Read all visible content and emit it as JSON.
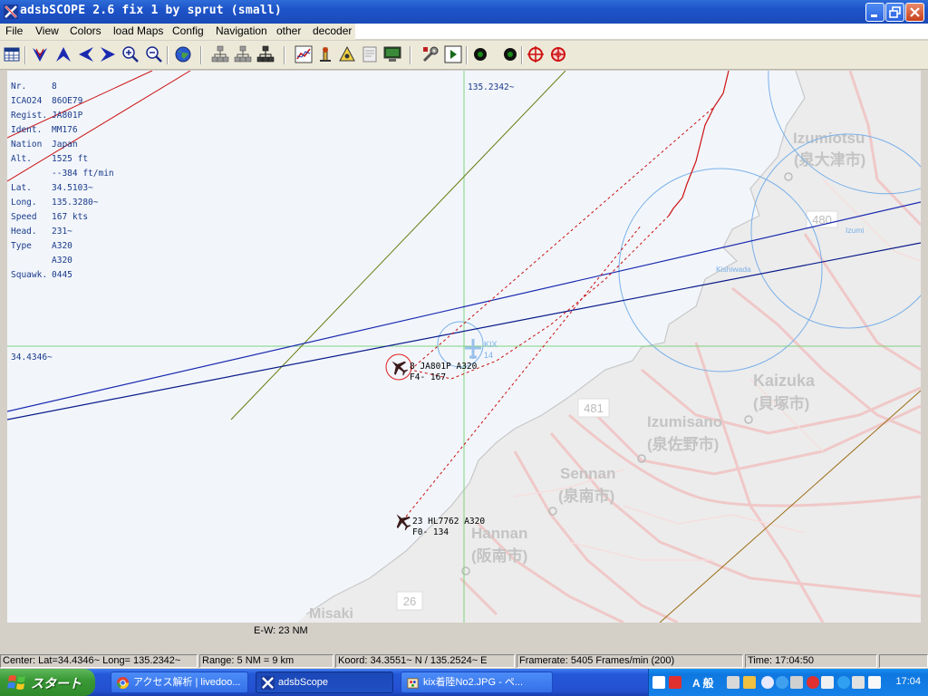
{
  "window": {
    "title": "adsbSCOPE 2.6 fix 1 by sprut  (small)"
  },
  "menu": [
    "File",
    "View",
    "Colors",
    "load Maps",
    "Config",
    "Navigation",
    "other",
    "decoder"
  ],
  "toolbar": {
    "icons": [
      "table-icon",
      "arrow-down-icon",
      "arrow-up-icon",
      "arrow-left-icon",
      "arrow-right-icon",
      "zoom-in-icon",
      "zoom-out-icon",
      "globe-icon",
      "network-icon",
      "network-icon",
      "network-icon",
      "chart-icon",
      "radar-icon",
      "alert-icon",
      "document-icon",
      "monitor-icon",
      "settings-icon",
      "play-icon",
      "record-icon",
      "record-icon",
      "target-icon",
      "target-icon"
    ]
  },
  "info_panel": {
    "rows": [
      {
        "label": "Nr.",
        "value": "8"
      },
      {
        "label": "ICAO24",
        "value": "86OE79"
      },
      {
        "label": "Regist.",
        "value": "JA801P"
      },
      {
        "label": "Ident.",
        "value": "MM176"
      },
      {
        "label": "Nation",
        "value": "Japan"
      },
      {
        "label": "Alt.",
        "value": "1525 ft"
      },
      {
        "label": "",
        "value": "--384 ft/min"
      },
      {
        "label": "Lat.",
        "value": "34.5103~"
      },
      {
        "label": "Long.",
        "value": "135.3280~"
      },
      {
        "label": "Speed",
        "value": "167 kts"
      },
      {
        "label": "Head.",
        "value": "231~"
      },
      {
        "label": "Type",
        "value": "A320"
      },
      {
        "label": "",
        "value": "A320"
      },
      {
        "label": "Squawk.",
        "value": "0445"
      }
    ]
  },
  "map": {
    "crosshair_long": "135.2342~",
    "crosshair_lat": "34.4346~",
    "airport_code": "KIX",
    "airport_sub": "14",
    "places": [
      {
        "name": "Izumiotsu",
        "jp": "(泉大津市)"
      },
      {
        "name": "Kaizuka",
        "jp": "(貝塚市)"
      },
      {
        "name": "Izumisano",
        "jp": "(泉佐野市)"
      },
      {
        "name": "Sennan",
        "jp": "(泉南市)"
      },
      {
        "name": "Hannan",
        "jp": "(阪南市)"
      },
      {
        "name": "Misaki",
        "jp": ""
      }
    ],
    "small_places": [
      "Izumi",
      "Kishiwada"
    ],
    "route_shields": [
      "480",
      "481",
      "26"
    ],
    "aircraft": [
      {
        "label1": "8  JA801P  A320",
        "label2": "F4- 167"
      },
      {
        "label1": "23  HL7762  A320",
        "label2": "F0- 134"
      }
    ],
    "colors": {
      "track_red": "#cc1010",
      "line_blue": "#1a2ab0",
      "line_navy": "#0a1a8a",
      "line_olive": "#6b7a10",
      "crosshair": "#7fd27f",
      "range_circle": "#7ab0e8"
    }
  },
  "scale": "E-W: 23 NM",
  "status": {
    "center": "Center: Lat=34.4346~  Long= 135.2342~",
    "range": "Range: 5 NM = 9 km",
    "koord": "Koord: 34.3551~ N / 135.2524~  E",
    "framerate": "Framerate:  5405 Frames/min (200)",
    "time": "Time: 17:04:50"
  },
  "taskbar": {
    "start": "スタート",
    "tasks": [
      {
        "label": "アクセス解析 | livedoo...",
        "icon": "chrome-icon"
      },
      {
        "label": "adsbScope",
        "icon": "adsbscope-icon"
      },
      {
        "label": "kix着陸No2.JPG - ペ...",
        "icon": "paint-icon"
      }
    ],
    "ime": "A 般",
    "clock": "17:04"
  }
}
